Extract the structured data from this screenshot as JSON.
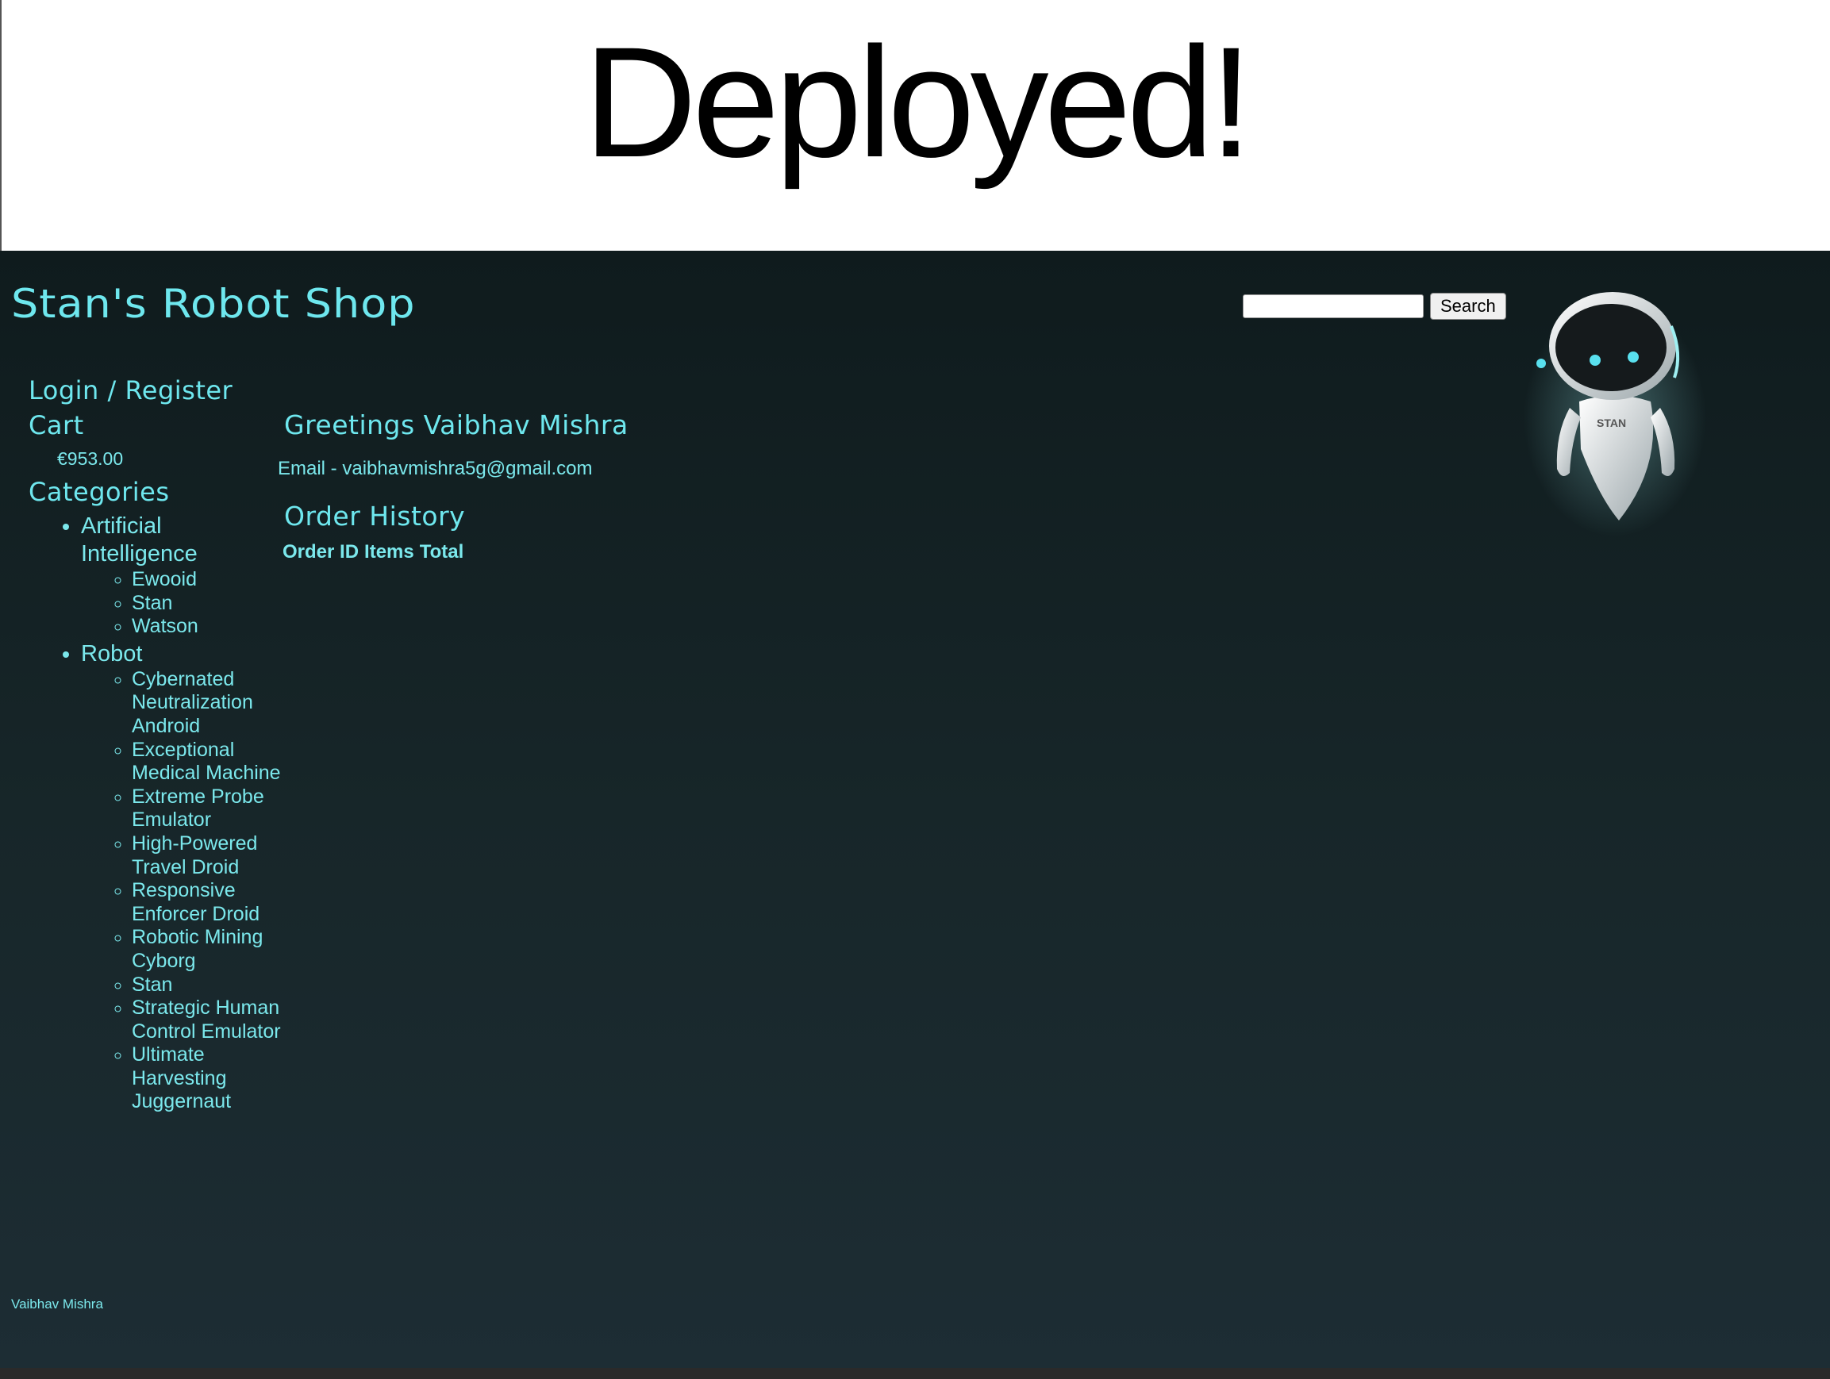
{
  "slide": {
    "title": "Deployed!"
  },
  "header": {
    "shop_title": "Stan's Robot Shop",
    "search_placeholder": "",
    "search_button": "Search",
    "robot_label": "STAN"
  },
  "nav": {
    "login": "Login / Register",
    "cart": "Cart",
    "cart_total": "€953.00",
    "categories": "Categories",
    "category_list": [
      {
        "name": "Artificial Intelligence",
        "items": [
          "Ewooid",
          "Stan",
          "Watson"
        ]
      },
      {
        "name": "Robot",
        "items": [
          "Cybernated Neutralization Android",
          "Exceptional Medical Machine",
          "Extreme Probe Emulator",
          "High-Powered Travel Droid",
          "Responsive Enforcer Droid",
          "Robotic Mining Cyborg",
          "Stan",
          "Strategic Human Control Emulator",
          "Ultimate Harvesting Juggernaut"
        ]
      }
    ]
  },
  "main": {
    "greeting": "Greetings Vaibhav Mishra",
    "email": "Email - vaibhavmishra5g@gmail.com",
    "order_history_title": "Order History",
    "order_columns": [
      "Order ID",
      "Items",
      "Total"
    ]
  },
  "footer": {
    "text": "Vaibhav Mishra"
  },
  "colors": {
    "accent": "#6ee7ee",
    "background_top": "#0f1b1d",
    "background_bottom": "#1d2d34"
  }
}
